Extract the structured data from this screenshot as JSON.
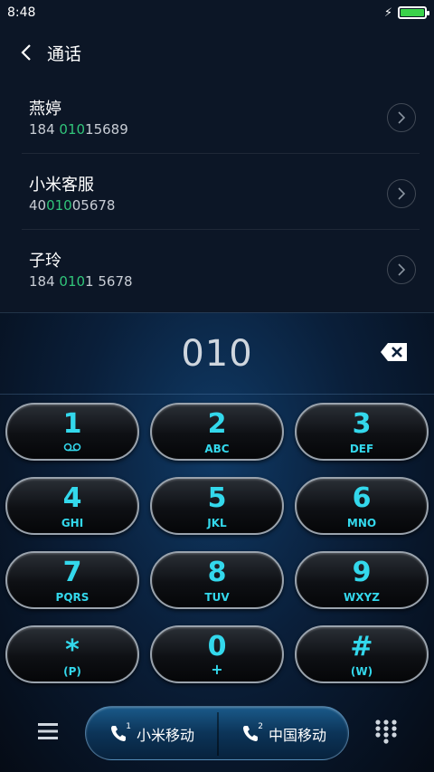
{
  "status": {
    "time": "8:48"
  },
  "header": {
    "title": "通话"
  },
  "contacts": [
    {
      "name": "燕婷",
      "number_pre": "184 ",
      "number_hl": "010",
      "number_post": "15689"
    },
    {
      "name": "小米客服",
      "number_pre": "40",
      "number_hl": "010",
      "number_post": "05678"
    },
    {
      "name": "子玲",
      "number_pre": "184 ",
      "number_hl": "010",
      "number_post": "1 5678"
    }
  ],
  "dialer": {
    "entered": "010"
  },
  "keys": [
    {
      "digit": "1",
      "letters": ""
    },
    {
      "digit": "2",
      "letters": "ABC"
    },
    {
      "digit": "3",
      "letters": "DEF"
    },
    {
      "digit": "4",
      "letters": "GHI"
    },
    {
      "digit": "5",
      "letters": "JKL"
    },
    {
      "digit": "6",
      "letters": "MNO"
    },
    {
      "digit": "7",
      "letters": "PQRS"
    },
    {
      "digit": "8",
      "letters": "TUV"
    },
    {
      "digit": "9",
      "letters": "WXYZ"
    },
    {
      "digit": "*",
      "letters": "(P)"
    },
    {
      "digit": "0",
      "letters": "+"
    },
    {
      "digit": "#",
      "letters": "(W)"
    }
  ],
  "calls": {
    "sim1_label": "小米移动",
    "sim1_num": "1",
    "sim2_label": "中国移动",
    "sim2_num": "2"
  },
  "colors": {
    "accent": "#33d8ec",
    "highlight": "#31c57a",
    "battery": "#3ad24a"
  }
}
